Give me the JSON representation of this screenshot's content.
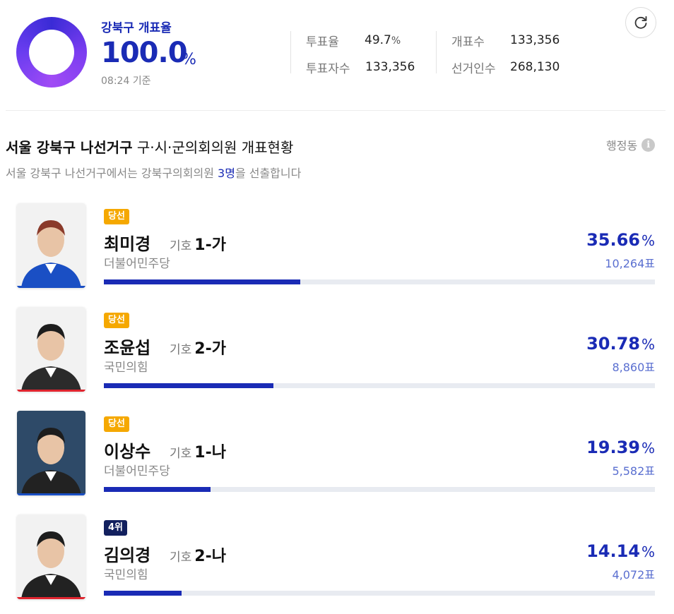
{
  "header": {
    "title": "강북구 개표율",
    "rate": "100.0",
    "rate_unit": "%",
    "time": "08:24 기준",
    "stats": {
      "turnout_label": "투표율",
      "turnout_value": "49.7",
      "turnout_unit": "%",
      "voters_label": "투표자수",
      "voters_value": "133,356",
      "counted_label": "개표수",
      "counted_value": "133,356",
      "electorate_label": "선거인수",
      "electorate_value": "268,130"
    },
    "refresh_icon": "refresh-icon"
  },
  "section": {
    "title_bold": "서울 강북구 나선거구",
    "title_rest": " 구·시·군의회의원 개표현황",
    "subtitle_pre": "서울 강북구 나선거구에서는 강북구의회의원 ",
    "subtitle_num": "3명",
    "subtitle_post": "을 선출합니다",
    "dong_label": "행정동",
    "info_icon": "info-icon"
  },
  "candidates": [
    {
      "badge": "당선",
      "name": "최미경",
      "symbol_label": "기호",
      "symbol": "1-가",
      "party": "더불어민주당",
      "pct": "35.66",
      "pct_unit": "%",
      "votes": "10,264표",
      "share": 0.3566,
      "party_color": "#1a4fc4",
      "suit_color": "#1a4fc4"
    },
    {
      "badge": "당선",
      "name": "조윤섭",
      "symbol_label": "기호",
      "symbol": "2-가",
      "party": "국민의힘",
      "pct": "30.78",
      "pct_unit": "%",
      "votes": "8,860표",
      "share": 0.3078,
      "party_color": "#e0252f",
      "suit_color": "#2b2b2b"
    },
    {
      "badge": "당선",
      "name": "이상수",
      "symbol_label": "기호",
      "symbol": "1-나",
      "party": "더불어민주당",
      "pct": "19.39",
      "pct_unit": "%",
      "votes": "5,582표",
      "share": 0.1939,
      "party_color": "#1a4fc4",
      "suit_color": "#222"
    },
    {
      "badge": "4위",
      "name": "김의경",
      "symbol_label": "기호",
      "symbol": "2-나",
      "party": "국민의힘",
      "pct": "14.14",
      "pct_unit": "%",
      "votes": "4,072표",
      "share": 0.1414,
      "party_color": "#e0252f",
      "suit_color": "#222"
    }
  ]
}
